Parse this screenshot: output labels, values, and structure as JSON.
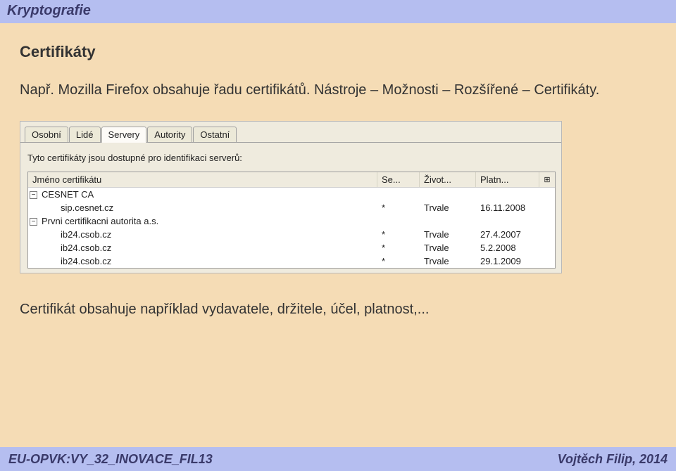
{
  "header": {
    "title": "Kryptografie"
  },
  "section": {
    "title": "Certifikáty"
  },
  "intro": {
    "line1": "Např. Mozilla Firefox obsahuje řadu certifikátů. Nástroje – Možnosti – Rozšířené – Certifikáty."
  },
  "screenshot": {
    "tabs": [
      "Osobní",
      "Lidé",
      "Servery",
      "Autority",
      "Ostatní"
    ],
    "activeTabIndex": 2,
    "description": "Tyto certifikáty jsou dostupné pro identifikaci serverů:",
    "columns": {
      "name": "Jméno certifikátu",
      "se": "Se...",
      "life": "Život...",
      "valid": "Platn..."
    },
    "rows": [
      {
        "type": "group",
        "name": "CESNET CA",
        "se": "",
        "life": "",
        "valid": ""
      },
      {
        "type": "child",
        "name": "sip.cesnet.cz",
        "se": "*",
        "life": "Trvale",
        "valid": "16.11.2008"
      },
      {
        "type": "group",
        "name": "Prvni certifikacni autorita a.s.",
        "se": "",
        "life": "",
        "valid": ""
      },
      {
        "type": "child",
        "name": "ib24.csob.cz",
        "se": "*",
        "life": "Trvale",
        "valid": "27.4.2007"
      },
      {
        "type": "child",
        "name": "ib24.csob.cz",
        "se": "*",
        "life": "Trvale",
        "valid": "5.2.2008"
      },
      {
        "type": "child",
        "name": "ib24.csob.cz",
        "se": "*",
        "life": "Trvale",
        "valid": "29.1.2009"
      }
    ]
  },
  "outro": "Certifikát obsahuje například vydavatele, držitele, účel, platnost,...",
  "footer": {
    "left": "EU-OPVK:VY_32_INOVACE_FIL13",
    "right": "Vojtěch Filip, 2014"
  }
}
